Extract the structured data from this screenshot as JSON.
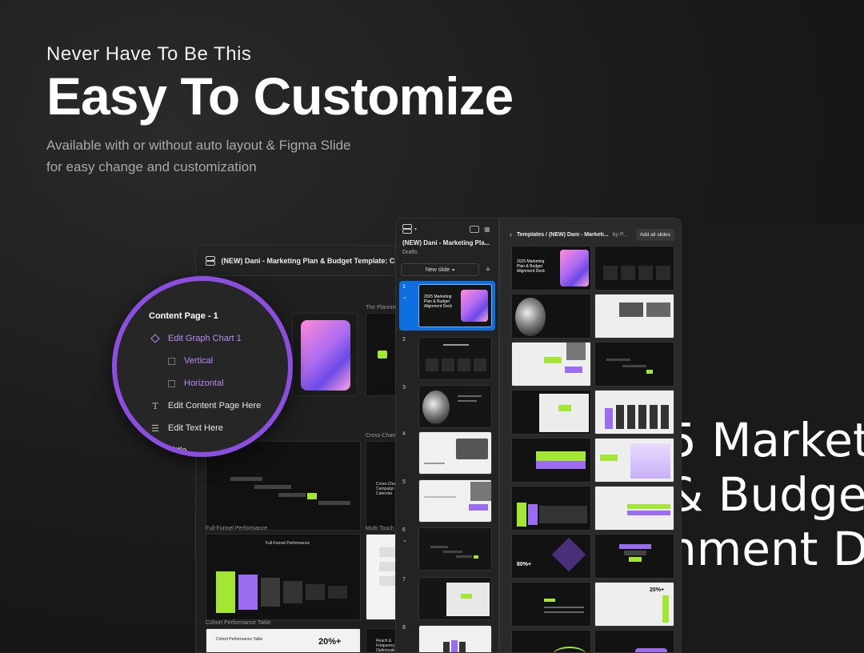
{
  "hero": {
    "kicker": "Never Have To Be This",
    "headline": "Easy To Customize",
    "subtext_line1": "Available with or without auto layout  & Figma Slide",
    "subtext_line2": "for easy change and customization"
  },
  "back_window": {
    "file_title": "(NEW) Dani - Marketing Plan & Budget Template: Calendar, ...",
    "sections": [
      "The Planning",
      "Cross-Chann",
      "Full-Funnel Performance",
      "Multi-Touch",
      "Cohort Performance Table"
    ],
    "thumb_texts": {
      "funnel_title": "Full-Funnel Performance",
      "cohort_title": "Cohort Performance Table",
      "cohort_value": "20%+",
      "cross_channel": "Cross-Channel Campaign Calendar",
      "reach": "Reach & Frequency Optimization"
    }
  },
  "layers": {
    "items": [
      {
        "label": "Content Page - 1",
        "icon": "none",
        "level": 0
      },
      {
        "label": "Edit Graph Chart 1",
        "icon": "component-diamond-icon",
        "level": 0,
        "selected": true
      },
      {
        "label": "Vertical",
        "icon": "frame-square-icon",
        "level": 1,
        "selected": true
      },
      {
        "label": "Horizontal",
        "icon": "frame-square-icon",
        "level": 1,
        "selected": true
      },
      {
        "label": "Edit Content Page Here",
        "icon": "text-icon",
        "level": 0
      },
      {
        "label": "Edit Text Here",
        "icon": "autolayout-icon",
        "level": 0
      },
      {
        "label": "Tittle",
        "icon": "text-icon",
        "level": 0
      }
    ],
    "accent": "#8b4fe0"
  },
  "slides_panel": {
    "file_title": "(NEW) Dani - Marketing Pla...",
    "location": "Drafts",
    "new_slide_label": "New slide",
    "plus_label": "+",
    "slide_numbers": [
      "1",
      "2",
      "3",
      "4",
      "5",
      "6",
      "7",
      "8"
    ],
    "slide1_text": "2025 Marketing Plan & Budget Alignment Deck",
    "active_color": "#0d6fe0"
  },
  "template_panel": {
    "breadcrumb": "Templates / (NEW) Dani - Marketi...",
    "by_label": "by P...",
    "add_all_label": "Add all slides",
    "cover_text": "2025 Marketing Plan & Budget Alignment Deck",
    "stat_value": "20%+",
    "stat_value2": "80%+"
  },
  "deck_title": {
    "line1": "5 Market",
    "line2": "& Budge",
    "line3": "nment D"
  },
  "colors": {
    "lime": "#a3e635",
    "purple": "#9b6cf0"
  }
}
